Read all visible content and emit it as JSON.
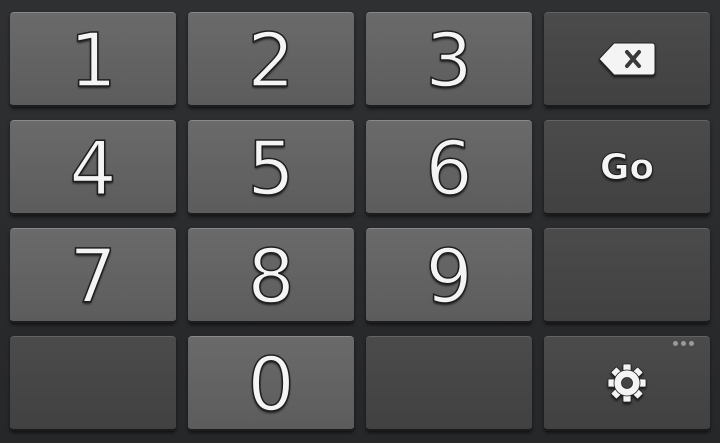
{
  "keypad": {
    "keys": {
      "k1": "1",
      "k2": "2",
      "k3": "3",
      "k4": "4",
      "k5": "5",
      "k6": "6",
      "k7": "7",
      "k8": "8",
      "k9": "9",
      "k0": "0"
    },
    "go_label": "Go",
    "backspace_icon": "backspace-icon",
    "settings_icon": "gear-icon",
    "more_icon": "more-options-icon"
  },
  "colors": {
    "background": "#2a2b2d",
    "digit_key": "#636363",
    "function_key": "#464646",
    "text": "#f4f4f4"
  }
}
